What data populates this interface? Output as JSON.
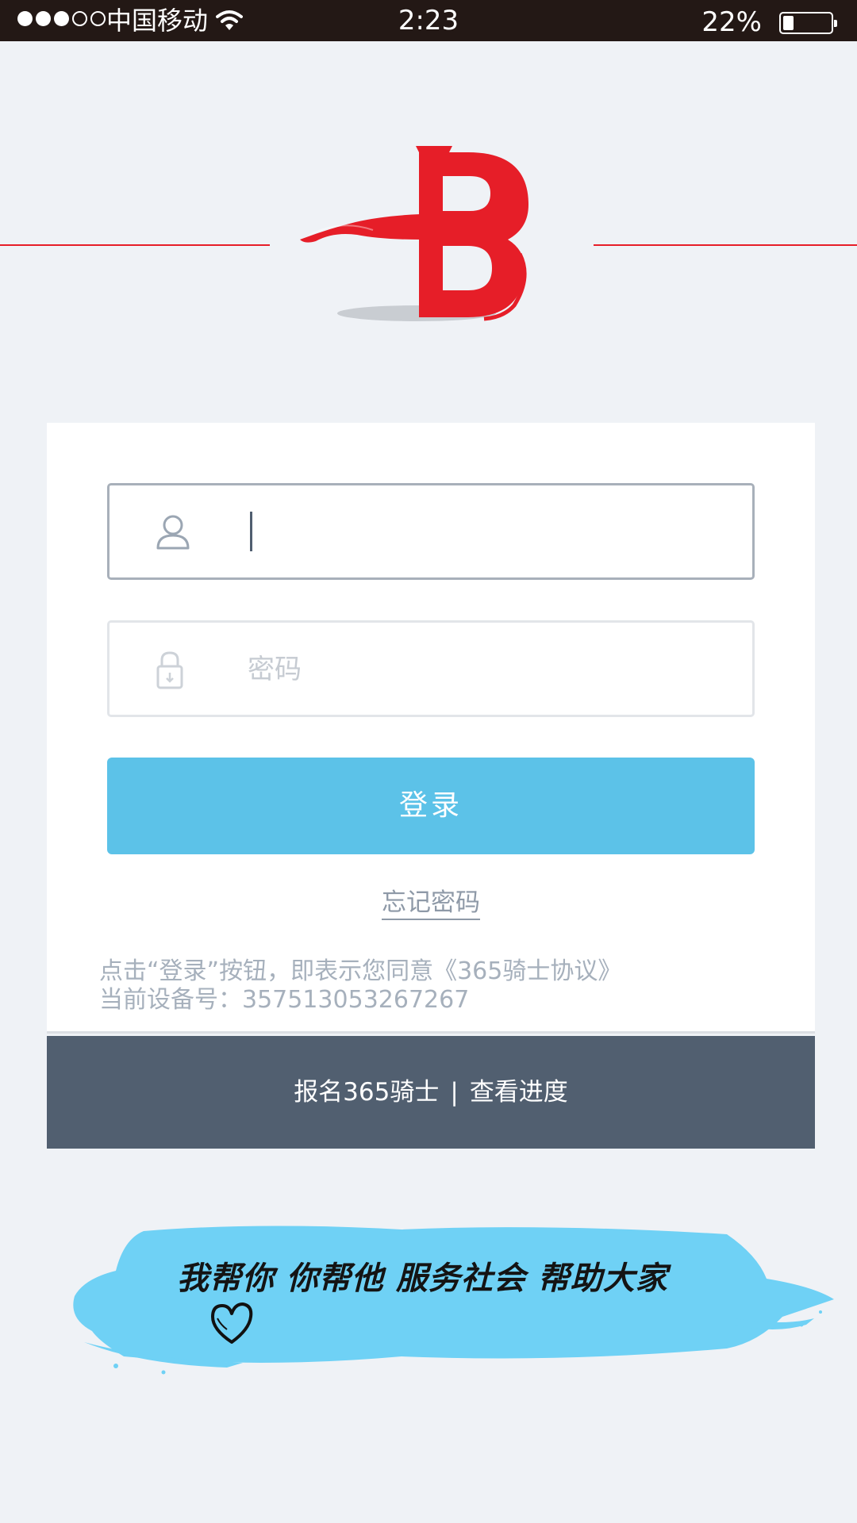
{
  "status_bar": {
    "carrier": "中国移动",
    "time": "2:23",
    "battery_percent": "22%",
    "battery_level": 0.22,
    "signal_bars_filled": 3,
    "signal_bars_total": 5,
    "icons": [
      "signal-dots-icon",
      "wifi-icon",
      "battery-icon"
    ]
  },
  "logo": {
    "icon": "flaming-b-logo",
    "color": "#e61e28"
  },
  "login_form": {
    "username": {
      "value": "",
      "placeholder": "",
      "icon": "user-icon"
    },
    "password": {
      "value": "",
      "placeholder": "密码",
      "icon": "lock-icon"
    },
    "login_button": "登录",
    "forgot_password": "忘记密码",
    "agreement_text": "点击“登录”按钮，即表示您同意《365骑士协议》",
    "device_label": "当前设备号：",
    "device_number": "357513053267267"
  },
  "footer": {
    "signup_link": "报名365骑士",
    "separator": "|",
    "progress_link": "查看进度"
  },
  "slogan": {
    "text": "我帮你 你帮他 服务社会 帮助大家",
    "icon": "heart-icon"
  },
  "colors": {
    "accent": "#5cc2e8",
    "brand_red": "#e61e28",
    "footer_bg": "#515f70",
    "background": "#eff2f6"
  }
}
